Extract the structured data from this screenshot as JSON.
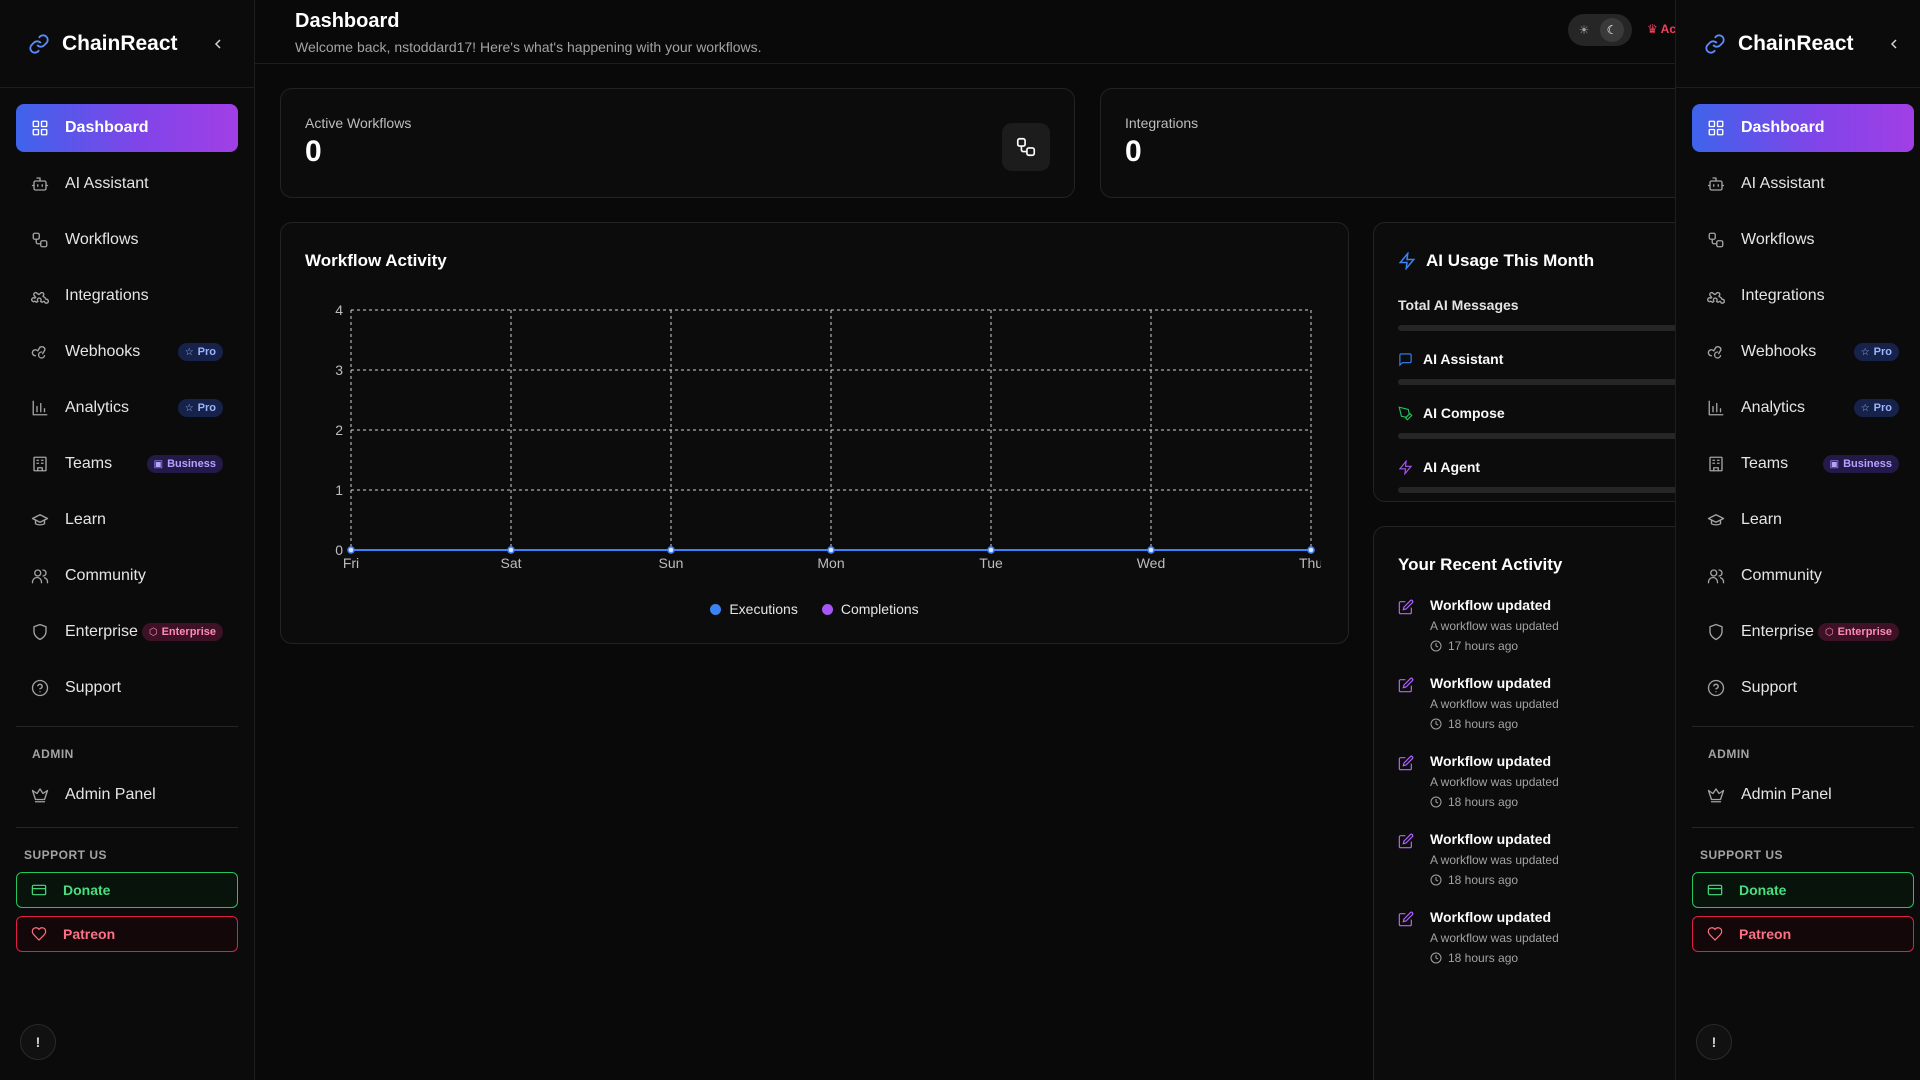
{
  "app": {
    "name": "ChainReact"
  },
  "sidebar": {
    "items": [
      {
        "label": "Dashboard",
        "icon": "dashboard-icon",
        "active": true
      },
      {
        "label": "AI Assistant",
        "icon": "bot-icon"
      },
      {
        "label": "Workflows",
        "icon": "workflow-icon"
      },
      {
        "label": "Integrations",
        "icon": "puzzle-icon"
      },
      {
        "label": "Webhooks",
        "icon": "webhook-icon",
        "badge": "Pro"
      },
      {
        "label": "Analytics",
        "icon": "bar-chart-icon",
        "badge": "Pro"
      },
      {
        "label": "Teams",
        "icon": "building-icon",
        "badge": "Business"
      },
      {
        "label": "Learn",
        "icon": "graduation-cap-icon"
      },
      {
        "label": "Community",
        "icon": "users-icon"
      },
      {
        "label": "Enterprise",
        "icon": "shield-icon",
        "badge": "Enterprise"
      },
      {
        "label": "Support",
        "icon": "help-circle-icon"
      }
    ],
    "admin_section": "ADMIN",
    "admin_item": "Admin Panel",
    "support_section": "SUPPORT US",
    "donate_label": "Donate",
    "patreon_label": "Patreon",
    "alert_label": "!"
  },
  "header": {
    "title": "Dashboard",
    "subtitle": "Welcome back, nstoddard17! Here's what's happening with your workflows.",
    "admin_chip": "Ac"
  },
  "stats": {
    "active_workflows": {
      "label": "Active Workflows",
      "value": "0"
    },
    "integrations": {
      "label": "Integrations",
      "value": "0"
    }
  },
  "activity_chart": {
    "title": "Workflow Activity"
  },
  "chart_data": {
    "type": "line",
    "x": [
      "Fri",
      "Sat",
      "Sun",
      "Mon",
      "Tue",
      "Wed",
      "Thu"
    ],
    "series": [
      {
        "name": "Executions",
        "values": [
          0,
          0,
          0,
          0,
          0,
          0,
          0
        ],
        "color": "#3b82f6"
      },
      {
        "name": "Completions",
        "values": [
          0,
          0,
          0,
          0,
          0,
          0,
          0
        ],
        "color": "#a855f7"
      }
    ],
    "title": "Workflow Activity",
    "ylim": [
      0,
      4
    ],
    "yticks": [
      0,
      1,
      2,
      3,
      4
    ],
    "grid": true,
    "legend": "bottom"
  },
  "ai_usage": {
    "title": "AI Usage This Month",
    "total_label": "Total AI Messages",
    "rows": [
      {
        "label": "AI Assistant",
        "icon": "message-square-icon"
      },
      {
        "label": "AI Compose",
        "icon": "pen-icon"
      },
      {
        "label": "AI Agent",
        "icon": "zap-icon"
      }
    ]
  },
  "recent_activity": {
    "title": "Your Recent Activity",
    "items": [
      {
        "title": "Workflow updated",
        "desc": "A workflow was updated",
        "time": "17 hours ago"
      },
      {
        "title": "Workflow updated",
        "desc": "A workflow was updated",
        "time": "18 hours ago"
      },
      {
        "title": "Workflow updated",
        "desc": "A workflow was updated",
        "time": "18 hours ago"
      },
      {
        "title": "Workflow updated",
        "desc": "A workflow was updated",
        "time": "18 hours ago"
      },
      {
        "title": "Workflow updated",
        "desc": "A workflow was updated",
        "time": "18 hours ago"
      }
    ]
  },
  "colors": {
    "accent_start": "#3f63ea",
    "accent_end": "#a13fe6",
    "executions": "#3b82f6",
    "completions": "#a855f7",
    "donate": "#22c55e",
    "patreon": "#e11d48"
  }
}
